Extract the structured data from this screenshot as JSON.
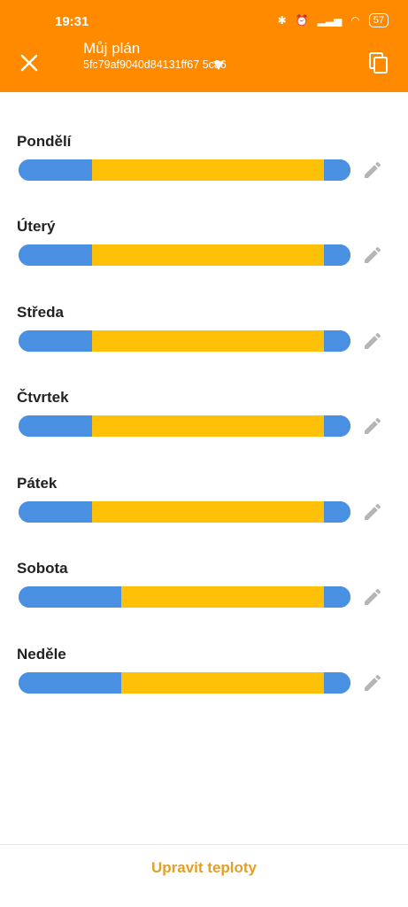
{
  "status": {
    "time": "19:31",
    "battery": "57"
  },
  "header": {
    "title": "Můj plán",
    "subtitle": "5fc79af9040d84131ff67 5c86"
  },
  "colors": {
    "accent": "#ff8a00",
    "cold": "#4a90e2",
    "warm": "#ffc107",
    "button_text": "#e0a02a"
  },
  "days": [
    {
      "label": "Pondělí",
      "segments": [
        {
          "mode": "cold",
          "percent": 22
        },
        {
          "mode": "warm",
          "percent": 70
        },
        {
          "mode": "cold",
          "percent": 8
        }
      ]
    },
    {
      "label": "Úterý",
      "segments": [
        {
          "mode": "cold",
          "percent": 22
        },
        {
          "mode": "warm",
          "percent": 70
        },
        {
          "mode": "cold",
          "percent": 8
        }
      ]
    },
    {
      "label": "Středa",
      "segments": [
        {
          "mode": "cold",
          "percent": 22
        },
        {
          "mode": "warm",
          "percent": 70
        },
        {
          "mode": "cold",
          "percent": 8
        }
      ]
    },
    {
      "label": "Čtvrtek",
      "segments": [
        {
          "mode": "cold",
          "percent": 22
        },
        {
          "mode": "warm",
          "percent": 70
        },
        {
          "mode": "cold",
          "percent": 8
        }
      ]
    },
    {
      "label": "Pátek",
      "segments": [
        {
          "mode": "cold",
          "percent": 22
        },
        {
          "mode": "warm",
          "percent": 70
        },
        {
          "mode": "cold",
          "percent": 8
        }
      ]
    },
    {
      "label": "Sobota",
      "segments": [
        {
          "mode": "cold",
          "percent": 31
        },
        {
          "mode": "warm",
          "percent": 61
        },
        {
          "mode": "cold",
          "percent": 8
        }
      ]
    },
    {
      "label": "Neděle",
      "segments": [
        {
          "mode": "cold",
          "percent": 31
        },
        {
          "mode": "warm",
          "percent": 61
        },
        {
          "mode": "cold",
          "percent": 8
        }
      ]
    }
  ],
  "footer": {
    "button_label": "Upravit teploty"
  },
  "icons": {
    "close": "close-icon",
    "dropdown": "dropdown-arrow-icon",
    "copy": "copy-icon",
    "edit": "pencil-icon"
  }
}
